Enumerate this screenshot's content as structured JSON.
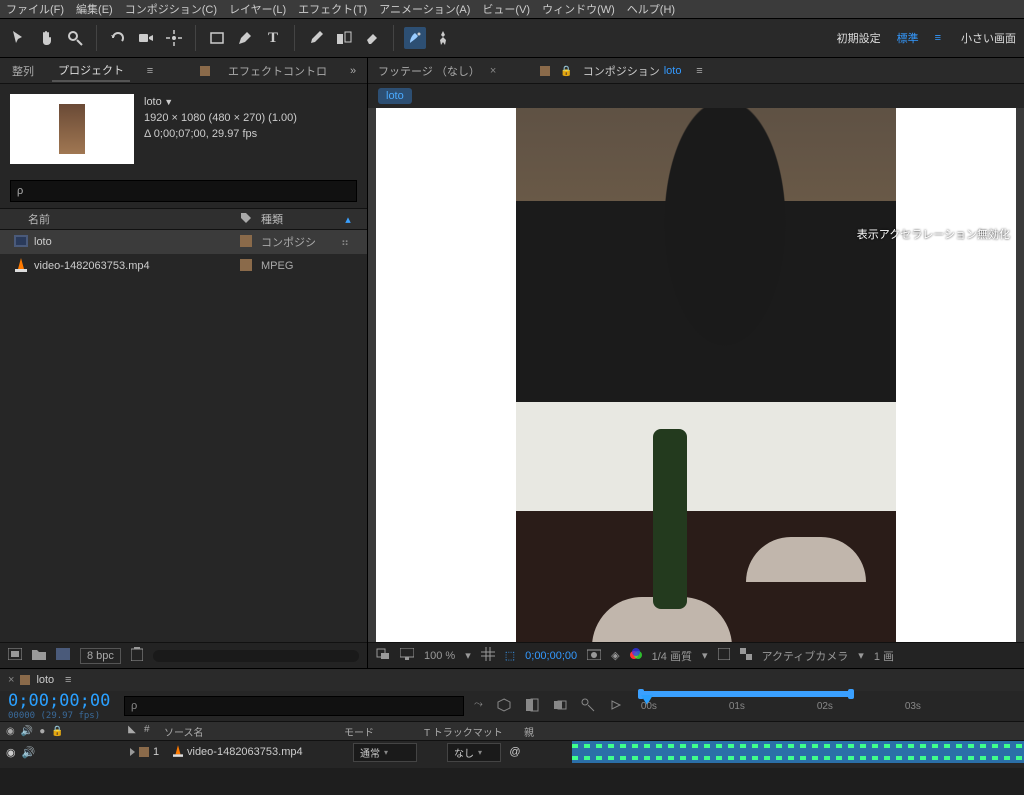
{
  "menubar": [
    "ファイル(F)",
    "編集(E)",
    "コンポジション(C)",
    "レイヤー(L)",
    "エフェクト(T)",
    "アニメーション(A)",
    "ビュー(V)",
    "ウィンドウ(W)",
    "ヘルプ(H)"
  ],
  "toolbar_right": {
    "preset": "初期設定",
    "workspace": "標準",
    "small_screen": "小さい画面"
  },
  "left_tabs": {
    "align": "整列",
    "project": "プロジェクト",
    "effect": "エフェクトコントロ"
  },
  "project": {
    "name": "loto",
    "dims": "1920 × 1080  (480 × 270) (1.00)",
    "dur": "Δ 0;00;07;00, 29.97 fps"
  },
  "search_placeholder": "ρ",
  "columns": {
    "name": "名前",
    "tag": "",
    "type": "種類"
  },
  "items": [
    {
      "icon": "comp",
      "name": "loto",
      "type": "コンポジシ",
      "sel": true
    },
    {
      "icon": "mpeg",
      "name": "video-1482063753.mp4",
      "type": "MPEG",
      "sel": false
    }
  ],
  "btmbar": {
    "bpc": "8 bpc"
  },
  "comp_tabs": {
    "footage": "フッテージ （なし）",
    "comp_prefix": "コンポジション",
    "comp_name": "loto"
  },
  "comp_chip": "loto",
  "overlay": "表示アクセラレーション無効化",
  "viewer_bar": {
    "zoom": "100 %",
    "tc": "0;00;00;00",
    "res": "1/4 画質",
    "camera": "アクティブカメラ",
    "views": "1 画"
  },
  "timeline": {
    "tab_name": "loto",
    "tc": "0;00;00;00",
    "tc_sub": "00000 (29.97 fps)",
    "headers": {
      "num": "#",
      "src": "ソース名",
      "mode": "モード",
      "tmat": "T トラックマット",
      "parent": "親"
    },
    "ticks": [
      "00s",
      "01s",
      "02s",
      "03s"
    ],
    "layer": {
      "num": "1",
      "name": "video-1482063753.mp4",
      "mode": "通常",
      "tmat": "なし"
    }
  }
}
